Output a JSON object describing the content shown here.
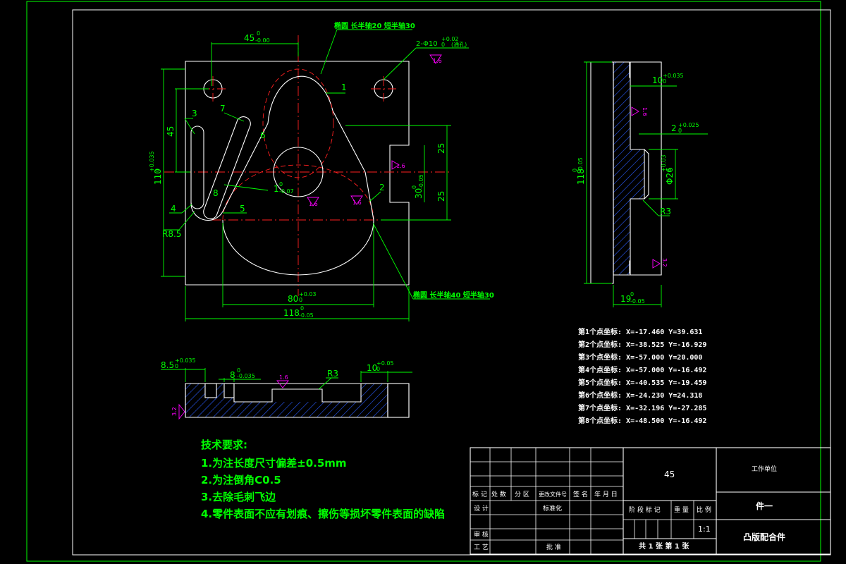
{
  "colors": {
    "background": "#000000",
    "outline": "#ffffff",
    "dimension": "#00ff00",
    "center_line": "#ff2020",
    "hatch": "#2a5cff",
    "roughness": "#ff00ff"
  },
  "front_view": {
    "dim_top": "45",
    "dim_top_tol": "0",
    "dim_top_tol2": "-0.00",
    "callout_ellipse_top": "椭圆 长半轴20 短半轴30",
    "callout_holes": "2-Φ10",
    "callout_holes_tol": "+0.02",
    "callout_holes_tol2": "0",
    "callout_holes_note": "(通孔)",
    "label_1": "1",
    "label_2": "2",
    "label_3": "3",
    "label_4": "4",
    "label_5": "5",
    "label_6": "6",
    "label_7": "7",
    "dim_45": "45",
    "dim_110": "110",
    "dim_110_tol": "+0.035",
    "dim_110_tol2": "0",
    "dim_25a": "25",
    "dim_25b": "25",
    "dim_30": "30",
    "dim_30_tol": "0",
    "dim_30_tol2": "-0.05",
    "dim_1": "1",
    "dim_1_tol": "0",
    "dim_1_tol2": "-0.07",
    "label_r8": "8",
    "label_r85": "R8.5",
    "dim_80": "80",
    "dim_80_tol": "+0.03",
    "dim_80_tol2": "0",
    "dim_118": "118",
    "dim_118_tol": "0",
    "dim_118_tol2": "-0.05",
    "callout_ellipse_bottom": "椭圆 长半轴40 短半轴30",
    "rough_16": "1.6"
  },
  "side_view": {
    "dim_10": "10",
    "dim_10_tol": "+0.035",
    "dim_10_tol2": "0",
    "dim_2": "2",
    "dim_2_tol": "+0.025",
    "dim_2_tol2": "0",
    "dim_118": "118",
    "dim_118_tol": "0",
    "dim_118_tol2": "-0.05",
    "dim_26": "Φ26",
    "dim_26_tol": "+0.03",
    "dim_26_tol2": "0",
    "label_r3": "R3",
    "dim_19": "19",
    "dim_19_tol": "0",
    "dim_19_tol2": "-0.05",
    "rough_16": "1.6",
    "rough_32": "3.2"
  },
  "top_view": {
    "dim_85": "8.5",
    "dim_85_tol": "+0.035",
    "dim_85_tol2": "0",
    "dim_8": "8",
    "dim_8_tol": "0",
    "dim_8_tol2": "-0.035",
    "rough_16": "1.6",
    "label_r3": "R3",
    "dim_10": "10",
    "dim_10_tol": "+0.05",
    "dim_10_tol2": "0",
    "rough_32": "3.2"
  },
  "points": [
    "第1个点坐标: X=-17.460 Y=39.631",
    "第2个点坐标: X=-38.525 Y=-16.929",
    "第3个点坐标: X=-57.000 Y=20.000",
    "第4个点坐标: X=-57.000 Y=-16.492",
    "第5个点坐标: X=-40.535 Y=-19.459",
    "第6个点坐标: X=-24.230 Y=24.318",
    "第7个点坐标: X=-32.196 Y=-27.285",
    "第8个点坐标: X=-48.500 Y=-16.492"
  ],
  "tech": {
    "title": "技术要求:",
    "items": [
      "1.为注长度尺寸偏差±0.5mm",
      "2.为注倒角C0.5",
      "3.去除毛刺飞边",
      "4.零件表面不应有划痕、擦伤等损坏零件表面的缺陷"
    ]
  },
  "title_block": {
    "material": "45",
    "company": "工作单位",
    "part_no": "件一",
    "part_name": "凸版配合件",
    "scale": "1:1",
    "sheets": "共 1 张  第 1 张",
    "headers": [
      "标 记",
      "处 数",
      "分  区",
      "更改文件号",
      "签 名",
      "年 月 日"
    ],
    "design": "设 计",
    "standardize": "标准化",
    "review": "审 核",
    "process": "工 艺",
    "approve": "批 准",
    "stage": "阶 段 标 记",
    "weight": "重 量",
    "ratio": "比 例"
  }
}
